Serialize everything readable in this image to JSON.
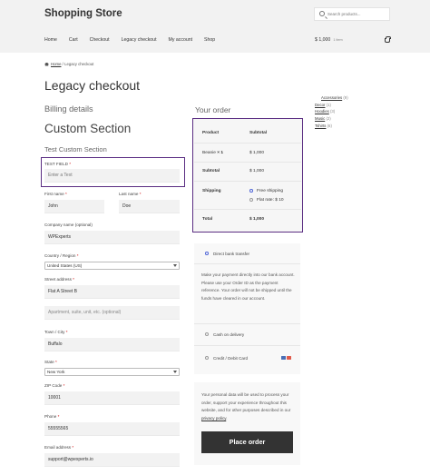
{
  "site": {
    "title": "Shopping Store"
  },
  "search": {
    "placeholder": "Search products..."
  },
  "nav": {
    "items": [
      "Home",
      "Cart",
      "Checkout",
      "Legacy checkout",
      "My account",
      "Shop"
    ]
  },
  "cart": {
    "total": "$ 1,000",
    "items_label": "1 item"
  },
  "breadcrumb": {
    "home": "Home",
    "current": "Legacy checkout",
    "separator": "/"
  },
  "page": {
    "title": "Legacy checkout",
    "billing_heading": "Billing details",
    "custom_section_heading": "Custom Section",
    "test_custom_heading": "Test Custom Section"
  },
  "form": {
    "test_field": {
      "label": "TEST FIELD",
      "placeholder": "Enter a Text"
    },
    "first_name": {
      "label": "First name",
      "value": "John"
    },
    "last_name": {
      "label": "Last name",
      "value": "Doe"
    },
    "company": {
      "label": "Company name (optional)",
      "value": "WPExperts"
    },
    "country": {
      "label": "Country / Region",
      "value": "United States (US)"
    },
    "street": {
      "label": "Street address",
      "value": "Flat A Street B",
      "placeholder2": "Apartment, suite, unit, etc. (optional)"
    },
    "city": {
      "label": "Town / City",
      "value": "Buffalo"
    },
    "state": {
      "label": "State",
      "value": "New York"
    },
    "zip": {
      "label": "ZIP Code",
      "value": "10001"
    },
    "phone": {
      "label": "Phone",
      "value": "55555565"
    },
    "email": {
      "label": "Email address",
      "value": "support@wpexperts.io"
    },
    "required_mark": "*"
  },
  "sidebar": {
    "categories": [
      {
        "name": "Accessories",
        "count": "(9)"
      },
      {
        "name": "Decor",
        "count": "(1)"
      },
      {
        "name": "Hoodies",
        "count": "(3)"
      },
      {
        "name": "Music",
        "count": "(2)"
      },
      {
        "name": "Tshirts",
        "count": "(6)"
      }
    ]
  },
  "order": {
    "heading": "Your order",
    "col_product": "Product",
    "col_subtotal": "Subtotal",
    "product_name": "Beanie",
    "product_qty": "× 1",
    "product_price": "$ 1,000",
    "subtotal_label": "Subtotal",
    "subtotal_value": "$ 1,000",
    "shipping_label": "Shipping",
    "shipping_options": [
      "Free shipping",
      "Flat rate: $ 10"
    ],
    "shipping_selected": 0,
    "total_label": "Total",
    "total_value": "$ 1,000"
  },
  "payment": {
    "options": [
      "Direct bank transfer",
      "Cash on delivery",
      "Credit / Debit Card"
    ],
    "selected": 0,
    "description": "Make your payment directly into our bank account. Please use your Order ID as the payment reference. Your order will not be shipped until the funds have cleared in our account.",
    "privacy_text": "Your personal data will be used to process your order, support your experience throughout this website, and for other purposes described in our",
    "privacy_link": "privacy policy",
    "place_order_label": "Place order"
  },
  "colors": {
    "highlight": "#5a2d82",
    "button": "#333333",
    "radio_selected": "#5a6fd8"
  }
}
